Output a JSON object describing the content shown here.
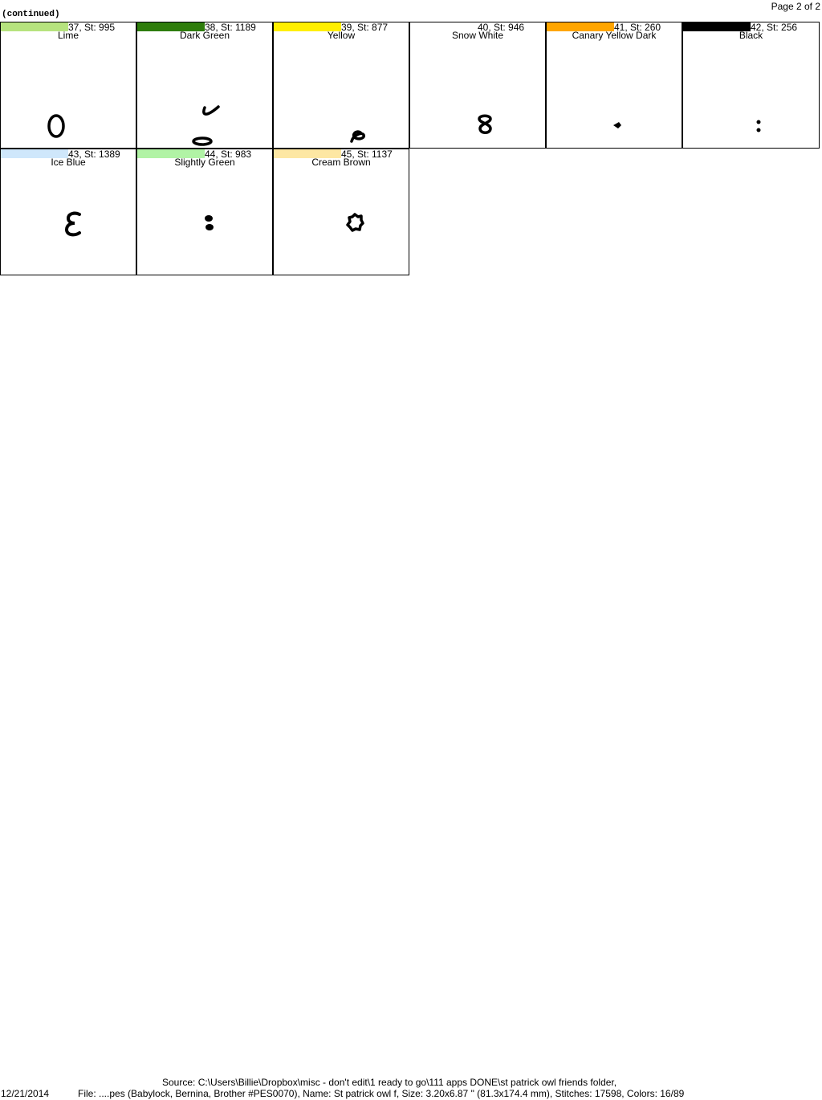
{
  "header": {
    "continued": "(continued)",
    "page_number": "Page 2 of 2"
  },
  "colors": [
    {
      "label": "37, St: 995",
      "name": "Lime",
      "swatch": "#b6e37e",
      "glyph": "ring-o"
    },
    {
      "label": "38, St: 1189",
      "name": "Dark Green",
      "swatch": "#2e7d0c",
      "glyph": "eyebrow-and-oval"
    },
    {
      "label": "39, St: 877",
      "name": "Yellow",
      "swatch": "#ffef00",
      "glyph": "small-loop"
    },
    {
      "label": "40, St: 946",
      "name": "Snow White",
      "swatch": "#ffffff",
      "glyph": "figure-eight"
    },
    {
      "label": "41, St: 260",
      "name": "Canary Yellow Dark",
      "swatch": "#ffa500",
      "glyph": "dot"
    },
    {
      "label": "42, St: 256",
      "name": "Black",
      "swatch": "#000000",
      "glyph": "colon-dots"
    },
    {
      "label": "43, St: 1389",
      "name": "Ice Blue",
      "swatch": "#cfe7fb",
      "glyph": "epsilon-shape"
    },
    {
      "label": "44, St: 983",
      "name": "Slightly Green",
      "swatch": "#b1f3a5",
      "glyph": "double-blob"
    },
    {
      "label": "45, St: 1137",
      "name": "Cream Brown",
      "swatch": "#fde7a3",
      "glyph": "flower-ring"
    }
  ],
  "footer": {
    "source": "Source: C:\\Users\\Billie\\Dropbox\\misc - don't edit\\1 ready to go\\111 apps DONE\\st patrick owl friends folder,",
    "date": "12/21/2014",
    "file": "File: ....pes (Babylock, Bernina, Brother #PES0070), Name: St patrick owl f, Size: 3.20x6.87 \" (81.3x174.4 mm), Stitches: 17598, Colors: 16/89"
  }
}
